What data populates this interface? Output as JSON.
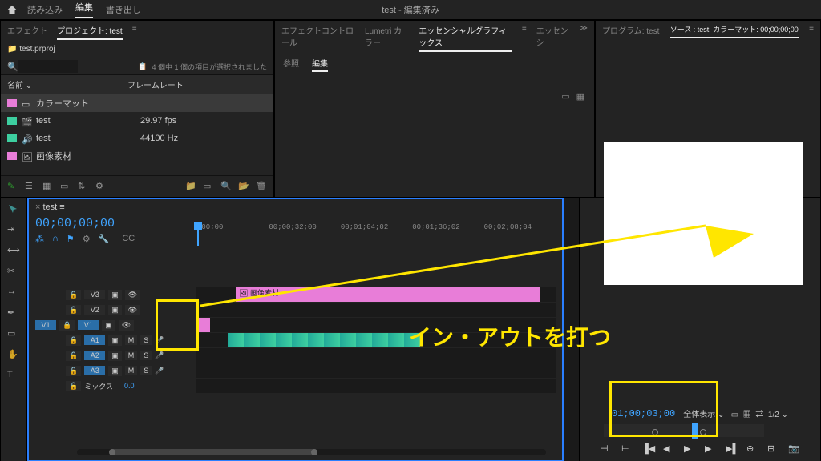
{
  "app": {
    "title": "test - 編集済み"
  },
  "top_tabs": {
    "import": "読み込み",
    "edit": "編集",
    "export": "書き出し"
  },
  "project_panel": {
    "tabs": {
      "effects": "エフェクト",
      "project": "プロジェクト: test"
    },
    "file": "test.prproj",
    "info": "4 個中 1 個の項目が選択されました",
    "col_name": "名前",
    "col_rate": "フレームレート",
    "items": [
      {
        "color": "#e87dd8",
        "icon": "file",
        "label": "カラーマット",
        "rate": ""
      },
      {
        "color": "#3dcfa0",
        "icon": "seq",
        "label": "test",
        "rate": "29.97 fps"
      },
      {
        "color": "#3dcfa0",
        "icon": "audio",
        "label": "test",
        "rate": "44100 Hz"
      },
      {
        "color": "#e87dd8",
        "icon": "img",
        "label": "画像素材",
        "rate": ""
      }
    ]
  },
  "effects_panel": {
    "tabs": {
      "ectrl": "エフェクトコントロール",
      "lumetri": "Lumetri カラー",
      "eg": "エッセンシャルグラフィックス",
      "es": "エッセンシ"
    },
    "sub": {
      "browse": "参照",
      "edit": "編集"
    }
  },
  "program_panel": {
    "tab_program": "プログラム: test",
    "tab_source": "ソース : test: カラーマット: 00;00;00;00",
    "timecode": "01;00;03;00",
    "zoom": "全体表示",
    "fraction": "1/2"
  },
  "timeline": {
    "tab": "test",
    "timecode": "00;00;00;00",
    "ruler": [
      ";00;00",
      "00;00;32;00",
      "00;01;04;02",
      "00;01;36;02",
      "00;02;08;04"
    ],
    "tracks": {
      "v3": "V3",
      "v2": "V2",
      "v1": "V1",
      "a1": "A1",
      "a2": "A2",
      "a3": "A3",
      "mix": "ミックス",
      "mix_val": "0.0"
    },
    "btns": {
      "m": "M",
      "s": "S"
    },
    "clip_label": "画像素材"
  },
  "annotation": {
    "text": "イン・アウトを打つ"
  }
}
